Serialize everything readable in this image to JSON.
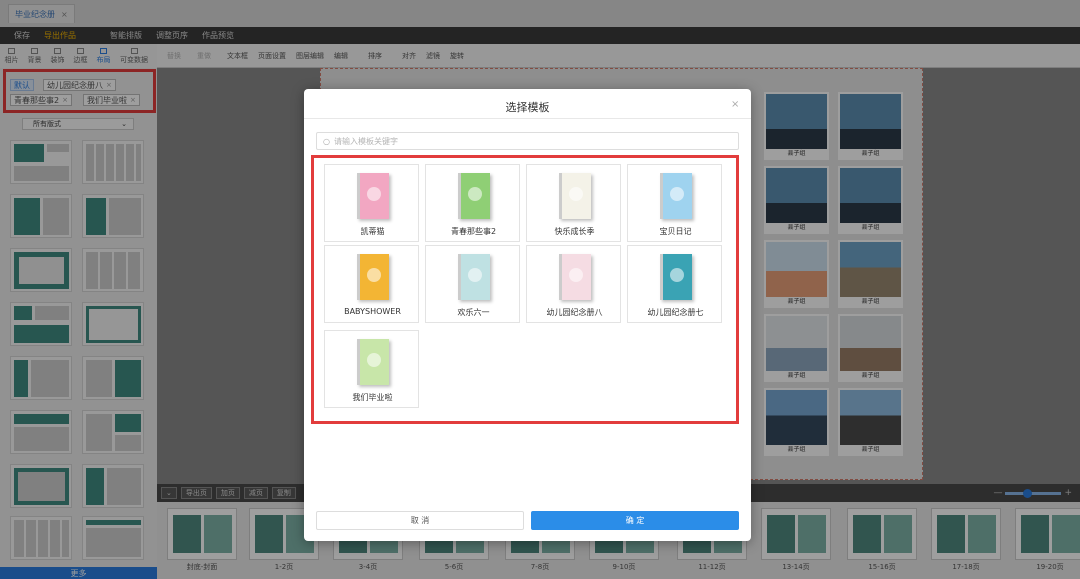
{
  "tab": {
    "title": "毕业纪念册",
    "close": "×"
  },
  "menu": {
    "items": [
      "保存",
      "导出作品",
      "智能排版",
      "调整页序",
      "作品预览"
    ],
    "active_index": 1
  },
  "left_tools": [
    "相片",
    "背景",
    "装饰",
    "边框",
    "布局",
    "可变数据"
  ],
  "left_tools_active": 4,
  "toolbar": {
    "items": [
      "替换",
      "重做",
      "文本框",
      "页面设置",
      "图层编辑",
      "编辑",
      "排序",
      "对齐",
      "滤镜",
      "旋转"
    ],
    "disabled": [
      0,
      1
    ]
  },
  "template_tags": {
    "row1": [
      {
        "label": "默认",
        "closable": false
      },
      {
        "label": "幼儿园纪念册八",
        "closable": true
      }
    ],
    "row2": [
      {
        "label": "青春那些事2",
        "closable": true
      },
      {
        "label": "我们毕业啦",
        "closable": true
      }
    ]
  },
  "style_select": {
    "value": "所有版式",
    "arrow": "⌄"
  },
  "more_label": "更多",
  "photo_caption": "县子组",
  "bottombar": {
    "buttons": [
      "导出页",
      "加页",
      "减页",
      "复制"
    ],
    "zoom_minus": "—",
    "zoom_plus": "+"
  },
  "filmstrip": [
    "封底-封面",
    "1-2页",
    "3-4页",
    "5-6页",
    "7-8页",
    "9-10页",
    "11-12页",
    "13-14页",
    "15-16页",
    "17-18页",
    "19-20页"
  ],
  "modal": {
    "title": "选择模板",
    "close": "×",
    "search_placeholder": "请输入模板关键字",
    "templates": [
      {
        "name": "凯蒂猫",
        "color": "#f2a7c2"
      },
      {
        "name": "青春那些事2",
        "color": "#8fcf75"
      },
      {
        "name": "快乐成长季",
        "color": "#f4f2e8"
      },
      {
        "name": "宝贝日记",
        "color": "#9fd3ef"
      },
      {
        "name": "BABYSHOWER",
        "color": "#f3b534"
      },
      {
        "name": "欢乐六一",
        "color": "#bfe1e3"
      },
      {
        "name": "幼儿园纪念册八",
        "color": "#f5dce3"
      },
      {
        "name": "幼儿园纪念册七",
        "color": "#3aa3b4"
      },
      {
        "name": "我们毕业啦",
        "color": "#c8e6a9"
      }
    ],
    "cancel_label": "取 消",
    "ok_label": "确 定"
  }
}
